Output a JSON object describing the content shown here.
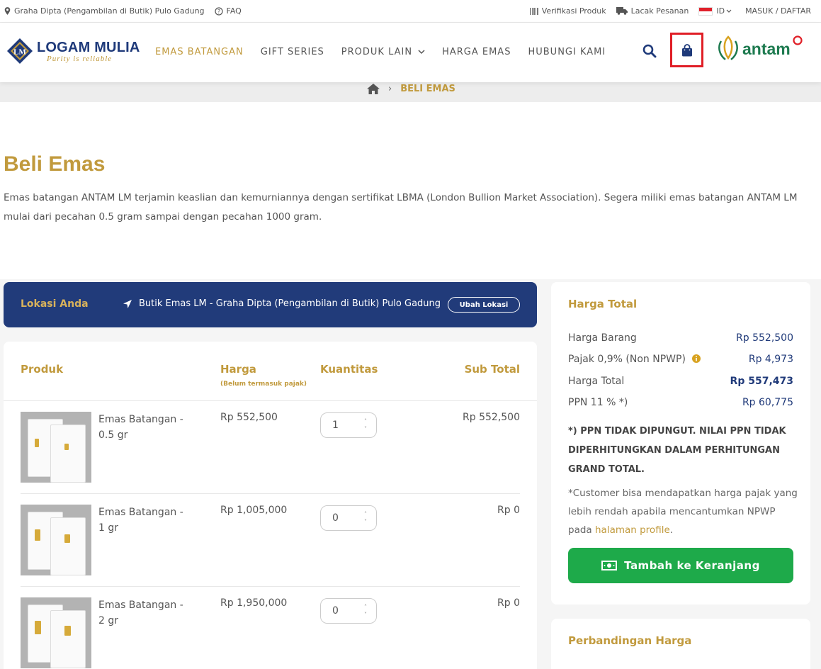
{
  "topbar": {
    "location": "Graha Dipta (Pengambilan di Butik) Pulo Gadung",
    "faq": "FAQ",
    "verifikasi": "Verifikasi Produk",
    "lacak": "Lacak Pesanan",
    "lang": "ID",
    "auth": "MASUK / DAFTAR"
  },
  "header": {
    "logo_title": "LOGAM MULIA",
    "logo_sub": "Purity is reliable",
    "logo_badge": "LM",
    "nav": [
      "EMAS BATANGAN",
      "GIFT SERIES",
      "PRODUK LAIN",
      "HARGA EMAS",
      "HUBUNGI KAMI"
    ],
    "brand": "antam"
  },
  "breadcrumb": {
    "current": "BELI EMAS"
  },
  "page": {
    "title": "Beli Emas",
    "description": "Emas batangan ANTAM LM terjamin keaslian dan kemurniannya dengan sertifikat LBMA (London Bullion Market Association). Segera miliki emas batangan ANTAM LM mulai dari pecahan 0.5 gram sampai dengan pecahan 1000 gram."
  },
  "lokasi": {
    "label": "Lokasi Anda",
    "address": "Butik Emas LM - Graha Dipta (Pengambilan di Butik) Pulo Gadung",
    "button": "Ubah Lokasi"
  },
  "table": {
    "col_produk": "Produk",
    "col_harga": "Harga",
    "col_harga_note": "(Belum termasuk pajak)",
    "col_kuantitas": "Kuantitas",
    "col_subtotal": "Sub Total",
    "rows": [
      {
        "name": "Emas Batangan - 0.5 gr",
        "price": "Rp 552,500",
        "qty": "1",
        "subtotal": "Rp 552,500"
      },
      {
        "name": "Emas Batangan - 1 gr",
        "price": "Rp 1,005,000",
        "qty": "0",
        "subtotal": "Rp 0"
      },
      {
        "name": "Emas Batangan - 2 gr",
        "price": "Rp 1,950,000",
        "qty": "0",
        "subtotal": "Rp 0"
      }
    ]
  },
  "summary": {
    "title": "Harga Total",
    "harga_barang_label": "Harga Barang",
    "harga_barang": "Rp 552,500",
    "pajak_label": "Pajak 0,9% (Non NPWP)",
    "pajak": "Rp 4,973",
    "harga_total_label": "Harga Total",
    "harga_total": "Rp 557,473",
    "ppn_label": "PPN 11 % *)",
    "ppn": "Rp 60,775",
    "note_ppn": "*) PPN TIDAK DIPUNGUT. NILAI PPN TIDAK DIPERHITUNGKAN DALAM PERHITUNGAN GRAND TOTAL.",
    "note_npwp": "*Customer bisa mendapatkan harga pajak yang lebih rendah apabila mencantumkan NPWP pada ",
    "note_link": "halaman profile",
    "note_end": ".",
    "button": "Tambah ke Keranjang"
  },
  "compare": {
    "title": "Perbandingan Harga"
  },
  "colors": {
    "gold": "#c19a3d",
    "navy": "#213b7a",
    "green": "#1eaa4a",
    "highlight": "#e01e26"
  }
}
